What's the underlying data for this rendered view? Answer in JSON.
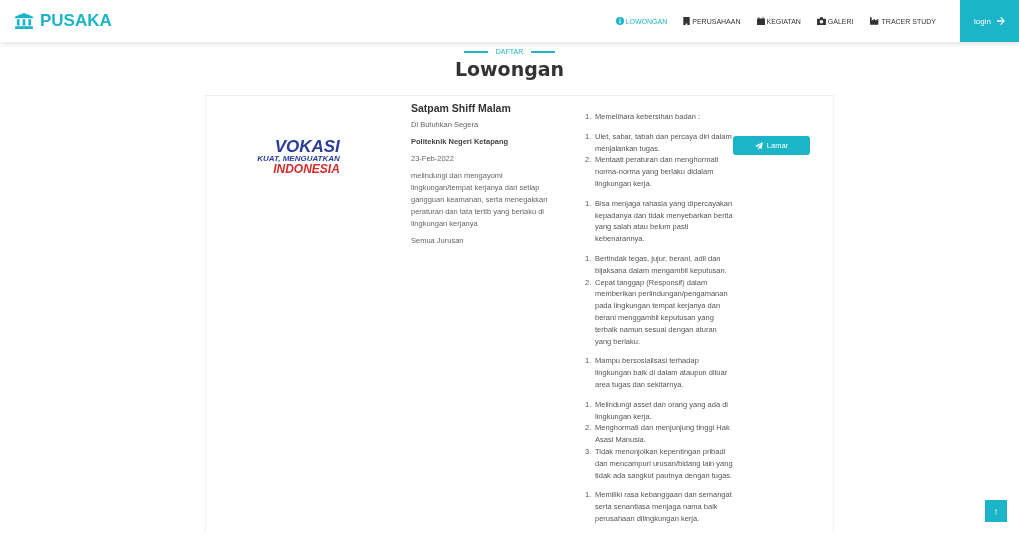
{
  "brand": {
    "name": "PUSAKA"
  },
  "nav": {
    "items": [
      {
        "label": "LOWONGAN",
        "selected": true
      },
      {
        "label": "PERUSAHAAN",
        "selected": false
      },
      {
        "label": "KEGIATAN",
        "selected": false
      },
      {
        "label": "GALERI",
        "selected": false
      },
      {
        "label": "TRACER STUDY",
        "selected": false
      }
    ],
    "login": "login"
  },
  "heading": {
    "eyebrow": "DAFTAR",
    "title": "Lowongan"
  },
  "job": {
    "logo": {
      "word": "VOKASI",
      "tagline": "KUAT, MENGUATKAN",
      "country": "INDONESIA"
    },
    "title": "Satpam Shiff Malam",
    "urgency": "Di Butuhkan Segera",
    "institution": "Politeknik Negeri Ketapang",
    "date": "23-Feb-2022",
    "description": "melindungi dan mengayomi lingkungan/tempat kerjanya dari setiap gangguan keamanan, serta menegakkan peraturan dan tata tertib yang berlaku di lingkungan kerjanya",
    "major": "Semua Jurusan",
    "requirements": [
      {
        "items": [
          {
            "num": "1.",
            "text": "Memelihara kebersihan badan :"
          }
        ]
      },
      {
        "items": [
          {
            "num": "1.",
            "text": "Ulet, sabar, tabah dan percaya diri dalam menjalankan tugas."
          },
          {
            "num": "2.",
            "text": "Mentaati peraturan dan menghormati norma-norma yang berlaku didalam lingkungan kerja."
          }
        ]
      },
      {
        "items": [
          {
            "num": "1.",
            "text": "Bisa menjaga rahasia yang dipercayakan kepadanya dan tidak menyebarkan berita yang salah atau belum pasti kebenarannya."
          }
        ]
      },
      {
        "items": [
          {
            "num": "1.",
            "text": "Bertindak tegas, jujur, berani, adil dan bijaksana dalam mengambil keputusan."
          },
          {
            "num": "2.",
            "text": "Cepat tanggap (Responsif) dalam memberikan perlindungan/pengamanan pada lingkungan tempat kerjanya dan berani menggambil keputusan yang terbaik namun sesuai dengan aturan yang berlaku."
          }
        ]
      },
      {
        "items": [
          {
            "num": "1.",
            "text": "Mampu bersosialisasi terhadap lingkungan baik di dalam ataupun diluar area tugas dan sekitarnya."
          }
        ]
      },
      {
        "items": [
          {
            "num": "1.",
            "text": "Melindungi asset dan orang yang ada di lingkungan kerja."
          },
          {
            "num": "2.",
            "text": "Menghormati dan menjunjung tinggi Hak Asasi Manusia."
          },
          {
            "num": "3.",
            "text": "Tidak menonjolkan kepentingan pribadi dan mencampuri urusan/bidang lain yang tidak ada sangkut pautnya dengan tugas."
          }
        ]
      },
      {
        "items": [
          {
            "num": "1.",
            "text": "Memiliki rasa kebanggaan dan semangat serta senantiasa menjaga nama baik perusahaan dilingkungan kerja."
          }
        ]
      }
    ],
    "apply": "Lamar"
  },
  "scroll_top": "↑"
}
